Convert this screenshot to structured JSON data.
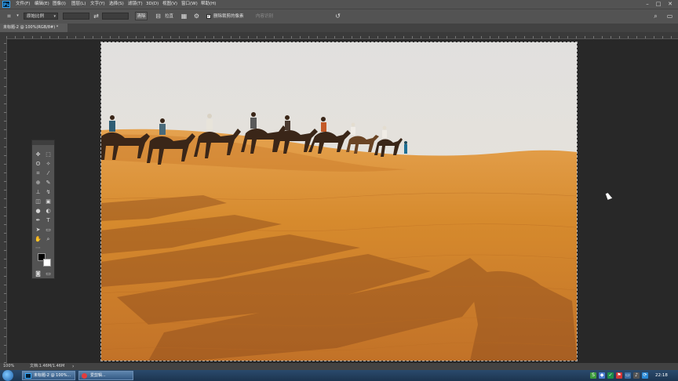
{
  "menubar": {
    "items": [
      "文件(F)",
      "编辑(E)",
      "图像(I)",
      "图层(L)",
      "文字(Y)",
      "选择(S)",
      "滤镜(T)",
      "3D(D)",
      "视图(V)",
      "窗口(W)",
      "帮助(H)"
    ],
    "logo": "Ps"
  },
  "options": {
    "ratio_label": "原始比例",
    "clear_label": "清除",
    "straighten_label": "拉直",
    "delete_pixels_label": "删除裁剪的像素",
    "content_aware_label": "内容识别"
  },
  "document": {
    "tab_title": "未标题-2 @ 100%(RGB/8#) *"
  },
  "status": {
    "zoom": "100%",
    "doc_size": "文档:1.46M/1.46M"
  },
  "taskbar": {
    "items": [
      "未标题-2 @ 100%...",
      "爱剪辑..."
    ],
    "clock": "22:18"
  },
  "colors": {
    "panel_bg": "#535353",
    "workspace_bg": "#282828",
    "accent": "#31a8ff"
  }
}
